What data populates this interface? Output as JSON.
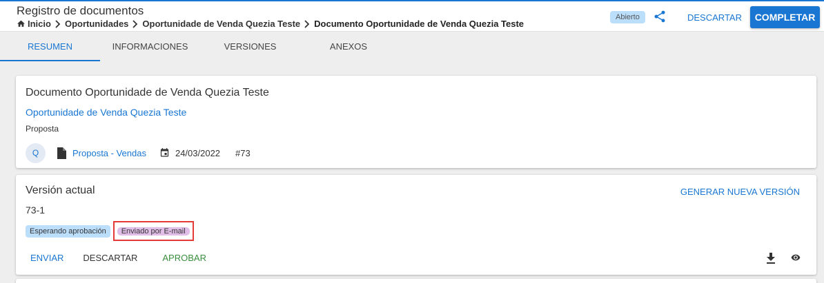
{
  "header": {
    "app_title": "Registro de documentos",
    "breadcrumb": [
      "Inicio",
      "Oportunidades",
      "Oportunidade de Venda Quezia Teste",
      "Documento Oportunidade de Venda Quezia Teste"
    ],
    "status": "Abierto",
    "discard_label": "DESCARTAR",
    "complete_label": "COMPLETAR"
  },
  "tabs": [
    {
      "label": "RESUMEN",
      "active": true
    },
    {
      "label": "INFORMACIONES",
      "active": false
    },
    {
      "label": "VERSIONES",
      "active": false
    },
    {
      "label": "ANEXOS",
      "active": false
    }
  ],
  "document": {
    "title": "Documento Oportunidade de Venda Quezia Teste",
    "opportunity_link": "Oportunidade de Venda Quezia Teste",
    "type": "Proposta",
    "avatar_initial": "Q",
    "template_link": "Proposta - Vendas",
    "date": "24/03/2022",
    "number": "#73"
  },
  "version": {
    "title": "Versión actual",
    "generate_label": "GENERAR NUEVA VERSIÓN",
    "number": "73-1",
    "badges": [
      "Esperando aprobación",
      "Enviado por E-mail"
    ],
    "actions": {
      "send": "ENVIAR",
      "discard": "DESCARTAR",
      "approve": "APROBAR"
    }
  },
  "colors": {
    "primary": "#1976d2",
    "approve": "#388e3c",
    "badge_wait": "#bbdefb",
    "badge_email": "#e1bee7",
    "highlight": "#e53935"
  },
  "icons": [
    "home-icon",
    "chevron-right-icon",
    "share-icon",
    "file-icon",
    "calendar-icon",
    "download-icon",
    "eye-icon"
  ]
}
